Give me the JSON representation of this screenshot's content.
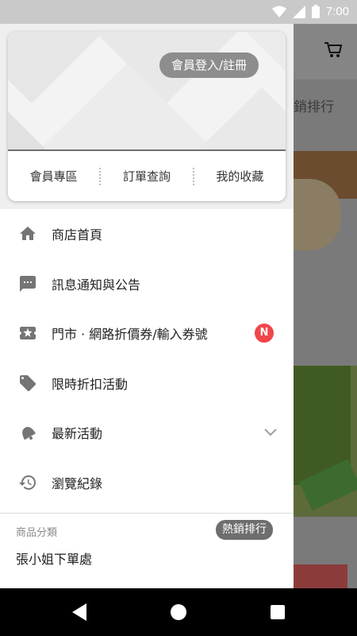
{
  "status_bar": {
    "time": "7:00"
  },
  "background": {
    "section_title": "銷排行"
  },
  "drawer": {
    "login_label": "會員登入/註冊",
    "card_links": [
      "會員專區",
      "訂單查詢",
      "我的收藏"
    ],
    "menu": [
      {
        "label": "商店首頁",
        "icon": "home-icon"
      },
      {
        "label": "訊息通知與公告",
        "icon": "message-icon"
      },
      {
        "label": "門市 · 網路折價券/輸入券號",
        "icon": "ticket-icon",
        "badge": "N"
      },
      {
        "label": "限時折扣活動",
        "icon": "tag-icon"
      },
      {
        "label": "最新活動",
        "icon": "bell-icon",
        "expandable": true
      },
      {
        "label": "瀏覽紀錄",
        "icon": "history-icon"
      }
    ],
    "category": {
      "title": "商品分類",
      "hot_label": "熱銷排行",
      "items": [
        "張小姐下單處"
      ]
    }
  },
  "colors": {
    "badge": "#f0454b",
    "pill": "#8d8d8d",
    "icon": "#757575"
  }
}
